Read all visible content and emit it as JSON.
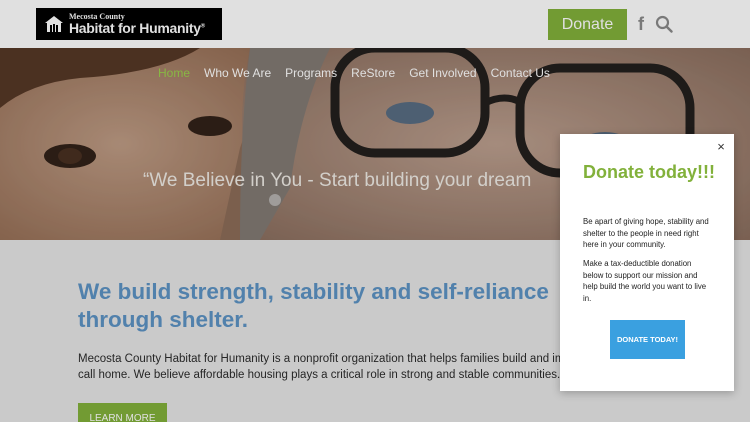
{
  "header": {
    "logo": {
      "line1": "Mecosta County",
      "line2": "Habitat for Humanity",
      "trademark": "®"
    },
    "donate_label": "Donate",
    "facebook_glyph": "f",
    "search_icon": "search-icon"
  },
  "nav": {
    "items": [
      {
        "label": "Home",
        "active": true
      },
      {
        "label": "Who We Are",
        "active": false
      },
      {
        "label": "Programs",
        "active": false
      },
      {
        "label": "ReStore",
        "active": false
      },
      {
        "label": "Get Involved",
        "active": false
      },
      {
        "label": "Contact Us",
        "active": false
      }
    ]
  },
  "hero": {
    "quote": "“We Believe in You - Start building your dream"
  },
  "main": {
    "heading": "We build strength, stability and self-reliance through shelter.",
    "body_line1": "Mecosta County Habitat for Humanity is a nonprofit organization that helps families build and imp",
    "body_line2": "call home. We believe affordable housing plays a critical role in strong and stable communities.",
    "learn_more_label": "LEARN MORE"
  },
  "modal": {
    "close_glyph": "×",
    "title": "Donate today!!!",
    "paragraph1": "Be apart of giving hope, stability and shelter to the people in need right here in your community.",
    "paragraph2": "Make a tax-deductible donation below to support our mission and help build the world you want to live in.",
    "button_label": "DONATE TODAY!"
  },
  "colors": {
    "accent_green": "#82b13b",
    "nav_active": "#9bd14e",
    "heading_blue": "#5d93c4",
    "modal_button_blue": "#3aa0e0"
  }
}
